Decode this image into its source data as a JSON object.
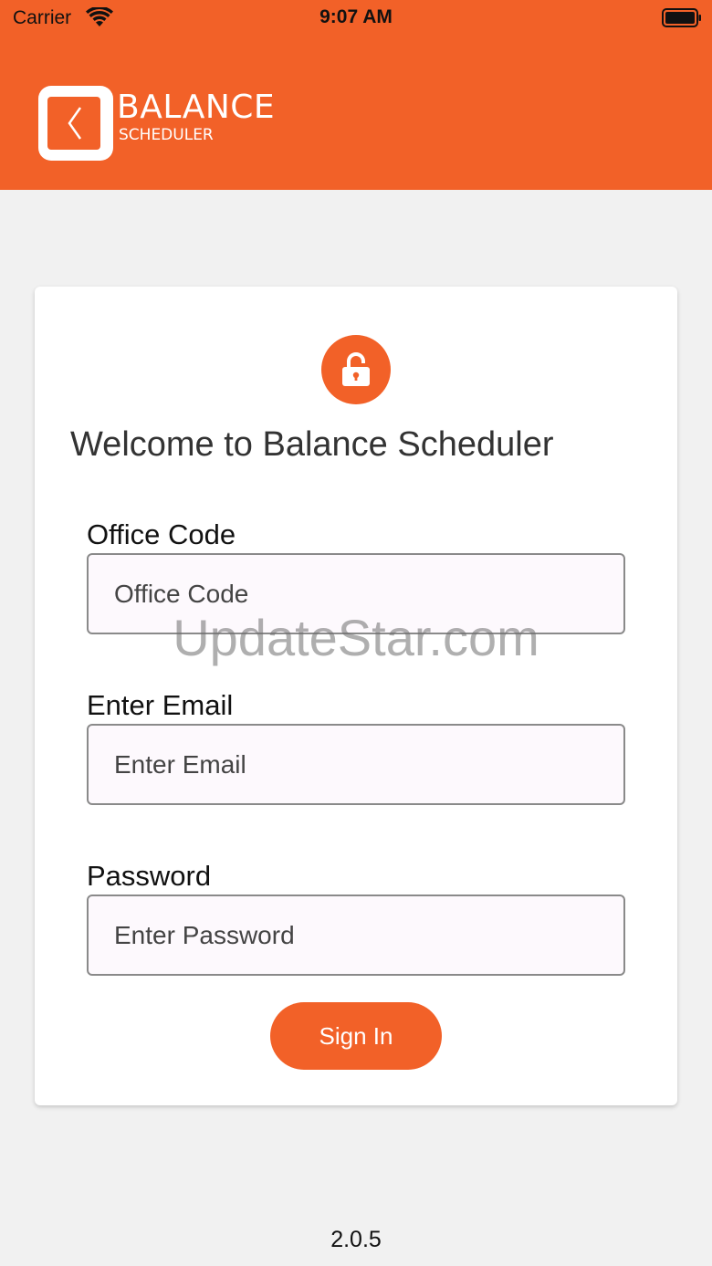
{
  "status_bar": {
    "carrier": "Carrier",
    "time": "9:07 AM",
    "wifi_icon": "wifi-icon",
    "battery_icon": "battery-icon"
  },
  "header": {
    "logo_name": "BALANCE",
    "logo_subtitle": "SCHEDULER",
    "logo_icon": "back-chevron-icon",
    "background_color": "#f26128"
  },
  "login_card": {
    "lock_icon": "lock-icon",
    "title": "Welcome to Balance Scheduler",
    "fields": [
      {
        "label": "Office Code",
        "placeholder": "Office Code",
        "value": ""
      },
      {
        "label": "Enter Email",
        "placeholder": "Enter Email",
        "value": ""
      },
      {
        "label": "Password",
        "placeholder": "Enter Password",
        "value": ""
      }
    ],
    "sign_in_label": "Sign In",
    "accent_color": "#f26128"
  },
  "watermark": "UpdateStar.com",
  "footer": {
    "version": "2.0.5"
  }
}
